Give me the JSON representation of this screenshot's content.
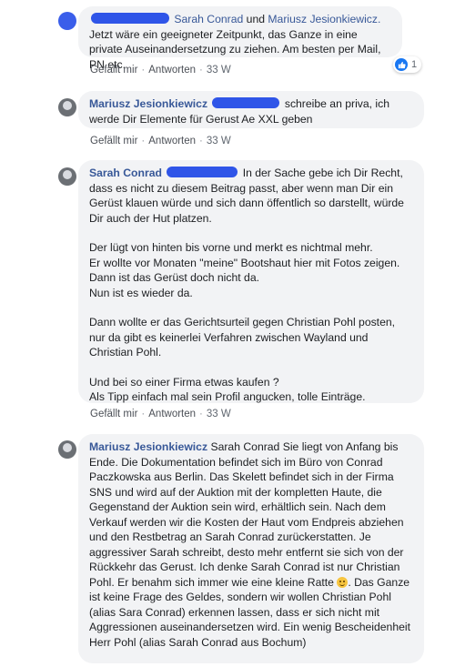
{
  "actions": {
    "like": "Gefällt mir",
    "reply": "Antworten",
    "age": "33 W"
  },
  "comments": [
    {
      "mention1": "Sarah Conrad",
      "connector": "und",
      "mention2": "Mariusz Jesionkiewicz.",
      "text": "Jetzt wäre ein geeigneter Zeitpunkt, das Ganze in eine private Auseinandersetzung zu ziehen. Am besten per Mail, PN etc.",
      "reaction_count": "1"
    },
    {
      "author": "Mariusz Jesionkiewicz",
      "text_after_redaction": "schreibe an priva, ich werde Dir Elemente für Gerust Ae XXL geben"
    },
    {
      "author": "Sarah Conrad",
      "paragraphs": [
        "In der Sache gebe ich Dir Recht, dass es nicht zu diesem Beitrag passt, aber wenn man Dir ein Gerüst klauen würde und sich dann öffentlich so darstellt, würde Dir auch der Hut platzen.",
        "Der lügt von hinten bis vorne und merkt es nichtmal mehr.",
        "Er wollte vor Monaten \"meine\" Bootshaut hier mit Fotos zeigen.",
        "Dann ist das Gerüst doch nicht da.",
        "Nun ist es wieder da.",
        "Dann wollte er das Gerichtsurteil gegen Christian Pohl posten, nur da gibt es keinerlei Verfahren zwischen Wayland und Christian Pohl.",
        "Und bei so einer Firma etwas kaufen ?",
        "Als Tipp einfach mal sein Profil angucken, tolle Einträge."
      ]
    },
    {
      "author": "Mariusz Jesionkiewicz",
      "text_before_emoji": "Sarah Conrad Sie liegt von Anfang bis Ende. Die Dokumentation befindet sich im Büro von Conrad Paczkowska aus Berlin. Das Skelett befindet sich in der Firma SNS und wird auf der Auktion mit der kompletten Haute, die Gegenstand der Auktion sein wird, erhältlich sein. Nach dem Verkauf werden wir die Kosten der Haut vom Endpreis abziehen und den Restbetrag an Sarah Conrad zurückerstatten. Je aggressiver Sarah schreibt, desto mehr entfernt sie sich von der Rückkehr das Gerust. Ich denke Sarah Conrad ist nur Christian Pohl. Er benahm sich immer wie eine kleine Ratte",
      "text_after_emoji": ". Das Ganze ist keine Frage des Geldes, sondern wir wollen Christian Pohl (alias Sara Conrad) erkennen lassen, dass er sich nicht mit Aggressionen auseinandersetzen wird. Ein wenig Bescheidenheit Herr Pohl (alias Sarah Conrad aus Bochum)"
    }
  ]
}
